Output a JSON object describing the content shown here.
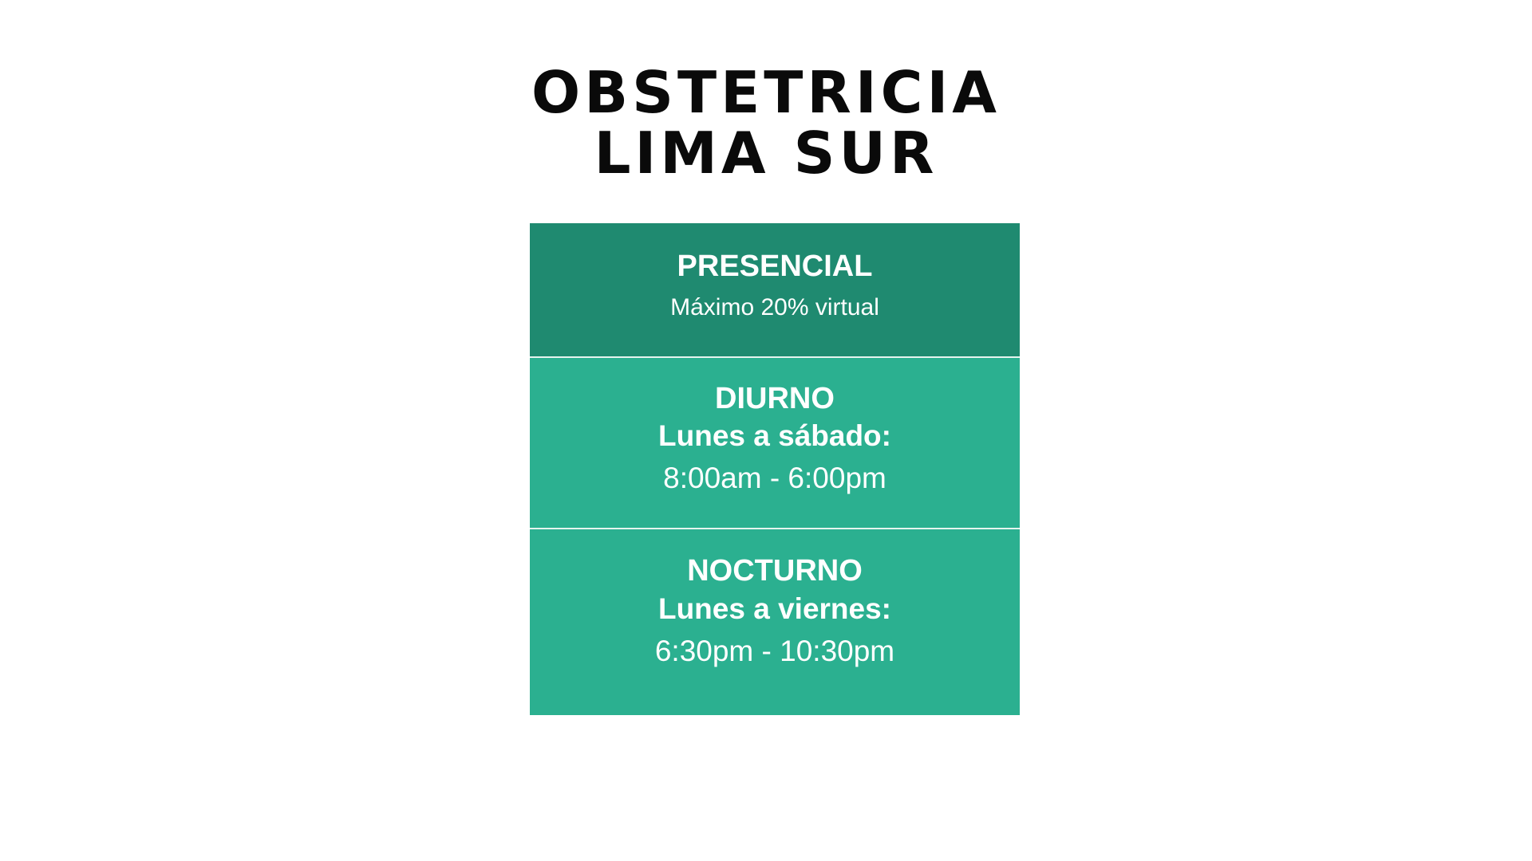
{
  "title": {
    "line1": "OBSTETRICIA",
    "line2": "LIMA SUR"
  },
  "modality": {
    "heading": "PRESENCIAL",
    "note": "Máximo 20% virtual"
  },
  "schedules": [
    {
      "shift": "DIURNO",
      "days": "Lunes a sábado:",
      "hours": "8:00am - 6:00pm"
    },
    {
      "shift": "NOCTURNO",
      "days": "Lunes a viernes:",
      "hours": "6:30pm - 10:30pm"
    }
  ],
  "colors": {
    "title_text": "#0a0a0a",
    "modality_background": "#1f8a70",
    "schedule_background": "#2bb090",
    "block_text": "#ffffff"
  }
}
